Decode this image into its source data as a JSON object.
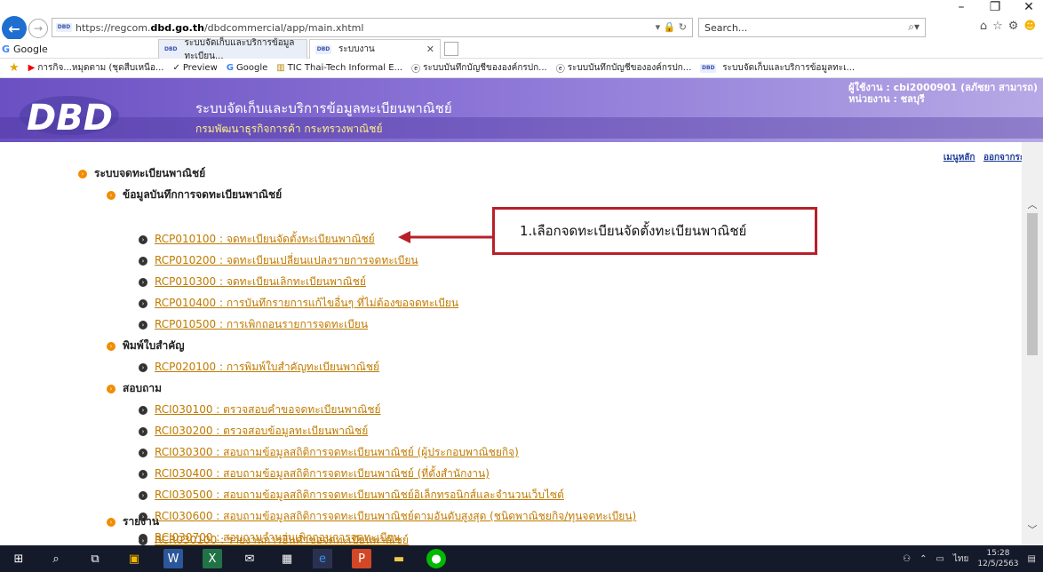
{
  "browser": {
    "url_prefix": "https://regcom.",
    "url_domain": "dbd.go.th",
    "url_path": "/dbdcommercial/app/main.xhtml",
    "search_placeholder": "Search...",
    "google_tab": "Google",
    "tabs": [
      {
        "label": "ระบบจัดเก็บและบริการข้อมูลทะเบียน..."
      },
      {
        "label": "ระบบงาน"
      }
    ],
    "favorites": [
      "การกิจ...หมุดตาม (ชุดสืบเหนือ...",
      "Preview",
      "Google",
      "TIC  Thai-Tech Informal E...",
      "ระบบบันทึกบัญชีขององค์กรปก...",
      "ระบบบันทึกบัญชีขององค์กรปก...",
      "ระบบจัดเก็บและบริการข้อมูลทะเ..."
    ],
    "favicon_text": "DBD",
    "win_minimize": "–",
    "win_maximize": "❐",
    "win_close": "✕"
  },
  "header": {
    "logo_text": "DBD",
    "title": "ระบบจัดเก็บและบริการข้อมูลทะเบียนพาณิชย์",
    "subtitle": "กรมพัฒนาธุรกิจการค้า  กระทรวงพาณิชย์",
    "user_line": "ผู้ใช้งาน : cbi2000901 (ลภัชยา สามารถ)",
    "unit_line": "หน่วยงาน : ชลบุรี"
  },
  "top_links": {
    "main_menu": "เมนูหลัก",
    "logout": "ออกจากระบบ"
  },
  "menu": {
    "root": "ระบบจดทะเบียนพาณิชย์",
    "section1": "ข้อมูลบันทึกการจดทะเบียนพาณิชย์",
    "s1_items": [
      "RCP010100 : จดทะเบียนจัดตั้งทะเบียนพาณิชย์",
      "RCP010200 : จดทะเบียนเปลี่ยนแปลงรายการจดทะเบียน",
      "RCP010300 : จดทะเบียนเลิกทะเบียนพาณิชย์",
      "RCP010400 : การบันทึกรายการแก้ไขอื่นๆ ที่ไม่ต้องขอจดทะเบียน",
      "RCP010500 : การเพิกถอนรายการจดทะเบียน"
    ],
    "section2": "พิมพ์ใบสำคัญ",
    "s2_items": [
      "RCP020100 : การพิมพ์ใบสำคัญทะเบียนพาณิชย์"
    ],
    "section3": "สอบถาม",
    "s3_items": [
      "RCI030100 : ตรวจสอบคำขอจดทะเบียนพาณิชย์",
      "RCI030200 : ตรวจสอบข้อมูลทะเบียนพาณิชย์",
      "RCI030300 : สอบถามข้อมูลสถิติการจดทะเบียนพาณิชย์ (ผู้ประกอบพาณิชยกิจ)",
      "RCI030400 : สอบถามข้อมูลสถิติการจดทะเบียนพาณิชย์ (ที่ตั้งสำนักงาน)",
      "RCI030500 : สอบถามข้อมูลสถิติการจดทะเบียนพาณิชย์อิเล็กทรอนิกส์และจำนวนเว็บไซต์",
      "RCI030600 : สอบถามข้อมูลสถิติการจดทะเบียนพาณิชย์ตามอันดับสูงสุด (ชนิดพาณิชยกิจ/ทุนจดทะเบียน)",
      "RCI030700 : สอบถามจำนวนเพิกถอนการจดทะเบียน"
    ],
    "section4": "รายงาน",
    "s4_items": [
      "RCR030100 : รายงานการยื่นคำขอจดทะเบียนพาณิชย์"
    ]
  },
  "callout": {
    "text": "1.เลือกจดทะเบียนจัดตั้งทะเบียนพาณิชย์"
  },
  "taskbar": {
    "time": "15:28",
    "date": "12/5/2563",
    "lang": "ไทย"
  },
  "colors": {
    "header_purple": "#6a50c2",
    "link_orange": "#c07a00",
    "callout_red": "#b8202a"
  }
}
